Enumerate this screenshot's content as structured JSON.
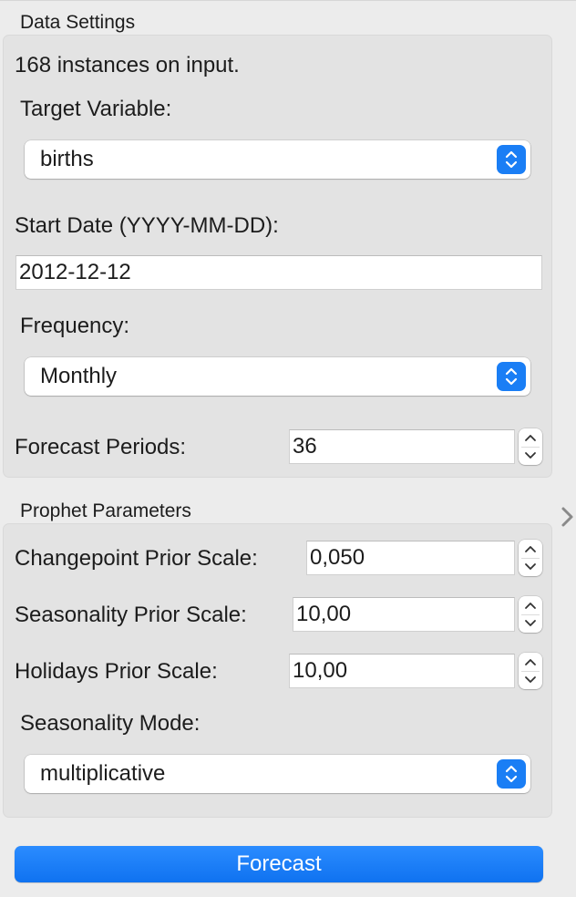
{
  "data_settings": {
    "title": "Data Settings",
    "instances_text": "168 instances on input.",
    "target_variable": {
      "label": "Target Variable:",
      "value": "births"
    },
    "start_date": {
      "label": "Start Date (YYYY-MM-DD):",
      "value": "2012-12-12"
    },
    "frequency": {
      "label": "Frequency:",
      "value": "Monthly"
    },
    "forecast_periods": {
      "label": "Forecast Periods:",
      "value": "36"
    }
  },
  "prophet_parameters": {
    "title": "Prophet Parameters",
    "changepoint_prior_scale": {
      "label": "Changepoint Prior Scale:",
      "value": "0,050"
    },
    "seasonality_prior_scale": {
      "label": "Seasonality Prior Scale:",
      "value": "10,00"
    },
    "holidays_prior_scale": {
      "label": "Holidays Prior Scale:",
      "value": "10,00"
    },
    "seasonality_mode": {
      "label": "Seasonality Mode:",
      "value": "multiplicative"
    }
  },
  "actions": {
    "forecast_label": "Forecast"
  },
  "icons": {
    "combo_arrows": "chevron-up-down-icon",
    "stepper_up": "chevron-up-icon",
    "stepper_down": "chevron-down-icon",
    "collapse": "chevron-right-icon"
  },
  "colors": {
    "accent": "#1a7ef5",
    "panel_background": "#ececec",
    "group_background": "#e3e3e3"
  }
}
